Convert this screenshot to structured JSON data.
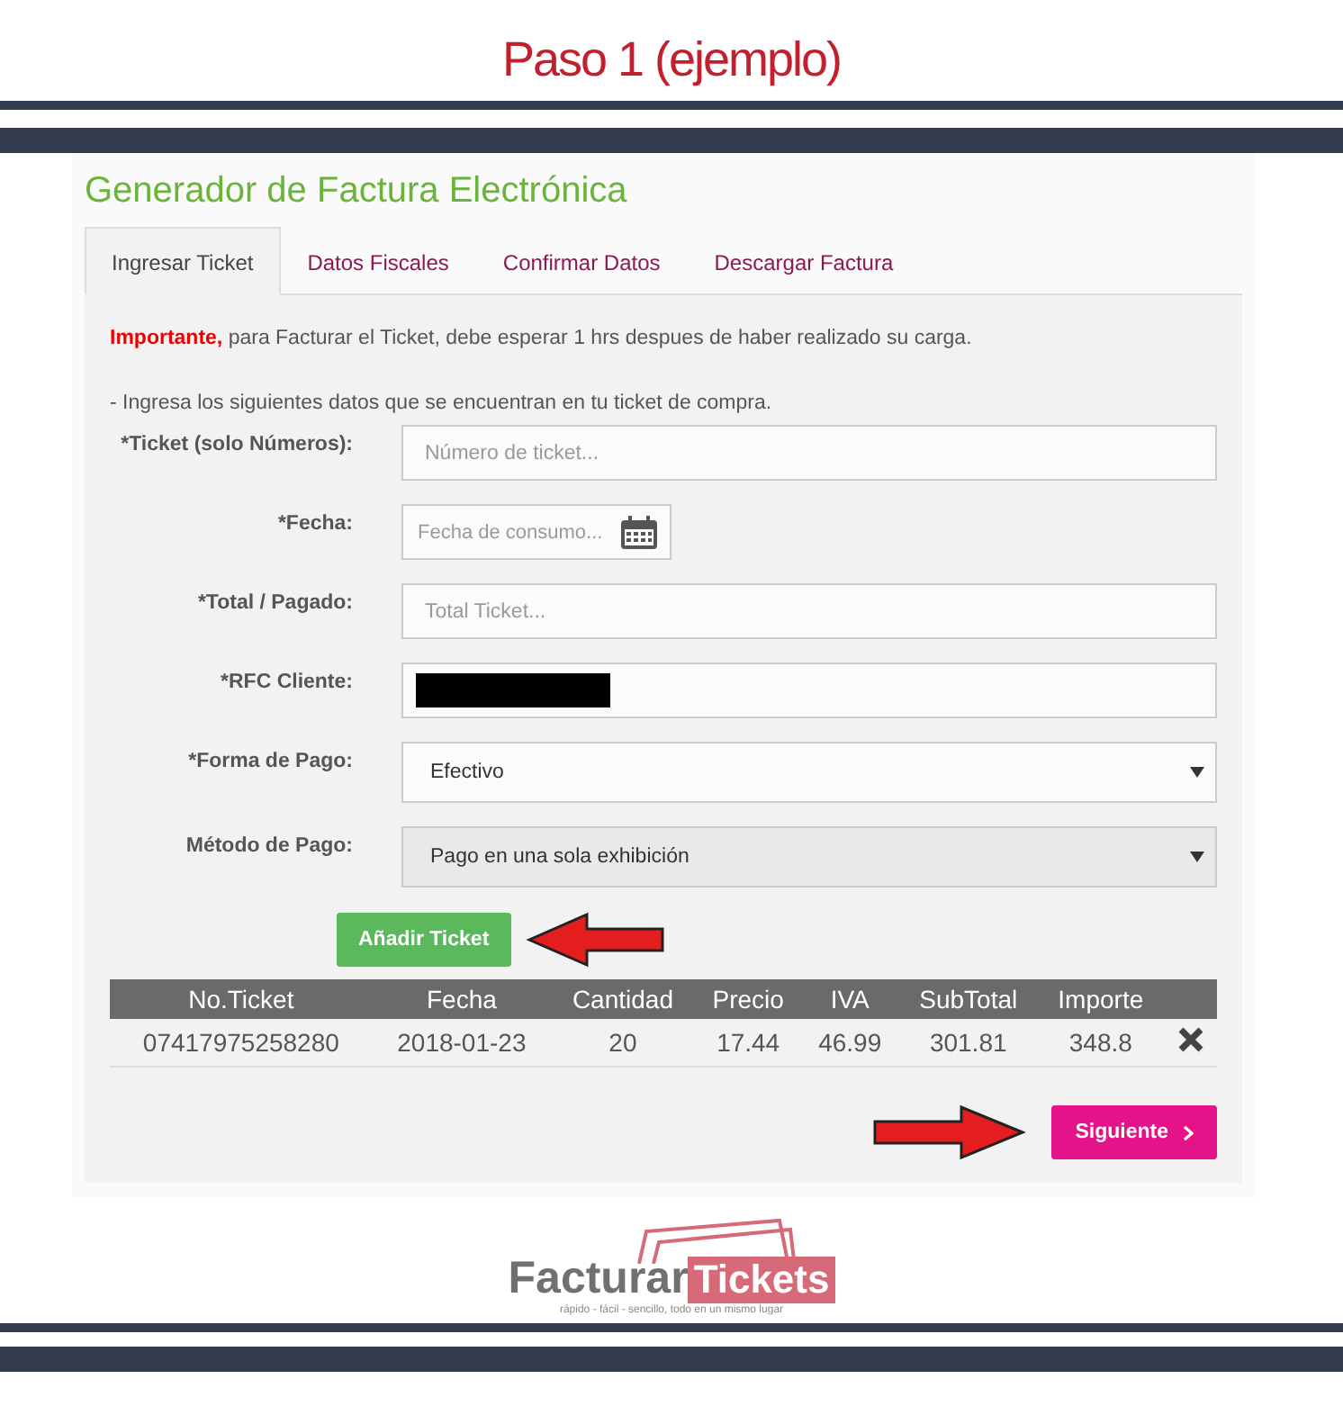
{
  "page_title": "Paso 1 (ejemplo)",
  "form_title": "Generador de Factura Electrónica",
  "tabs": [
    {
      "label": "Ingresar Ticket",
      "selected": true
    },
    {
      "label": "Datos Fiscales",
      "selected": false
    },
    {
      "label": "Confirmar Datos",
      "selected": false
    },
    {
      "label": "Descargar Factura",
      "selected": false
    }
  ],
  "notice": "**Importante,** para Facturar el Ticket, debe esperar 1 hrs despues de haber realizado su carga.",
  "instructions": "- Ingresa los siguientes datos que se encuentran en tu ticket de compra.",
  "fields": [
    {
      "kind": "text",
      "label": "*Ticket (solo Números):",
      "placeholder": "Número de ticket..."
    },
    {
      "kind": "date",
      "label": "*Fecha:",
      "placeholder": "Fecha de consumo..."
    },
    {
      "kind": "text",
      "label": "*Total / Pagado:",
      "placeholder": "Total Ticket..."
    },
    {
      "kind": "redacted",
      "label": "*RFC Cliente:"
    },
    {
      "kind": "select",
      "label": "*Forma de Pago:",
      "value": "Efectivo",
      "disabled": false
    },
    {
      "kind": "select",
      "label": "Método de Pago:",
      "value": "Pago en una sola exhibición",
      "disabled": true
    }
  ],
  "add_button": "Añadir Ticket",
  "table": {
    "columns": [
      "No.Ticket",
      "Fecha",
      "Cantidad",
      "Precio",
      "IVA",
      "SubTotal",
      "Importe"
    ],
    "rows": [
      {
        "cells": [
          "07417975258280",
          "2018-01-23",
          "20",
          "17.44",
          "46.99",
          "301.81",
          "348.8"
        ]
      }
    ]
  },
  "next_button": "Siguiente",
  "logo": {
    "word_1": "Facturar",
    "word_2": "Tickets",
    "tagline": "rápido - fácil - sencillo, todo en un mismo lugar"
  }
}
